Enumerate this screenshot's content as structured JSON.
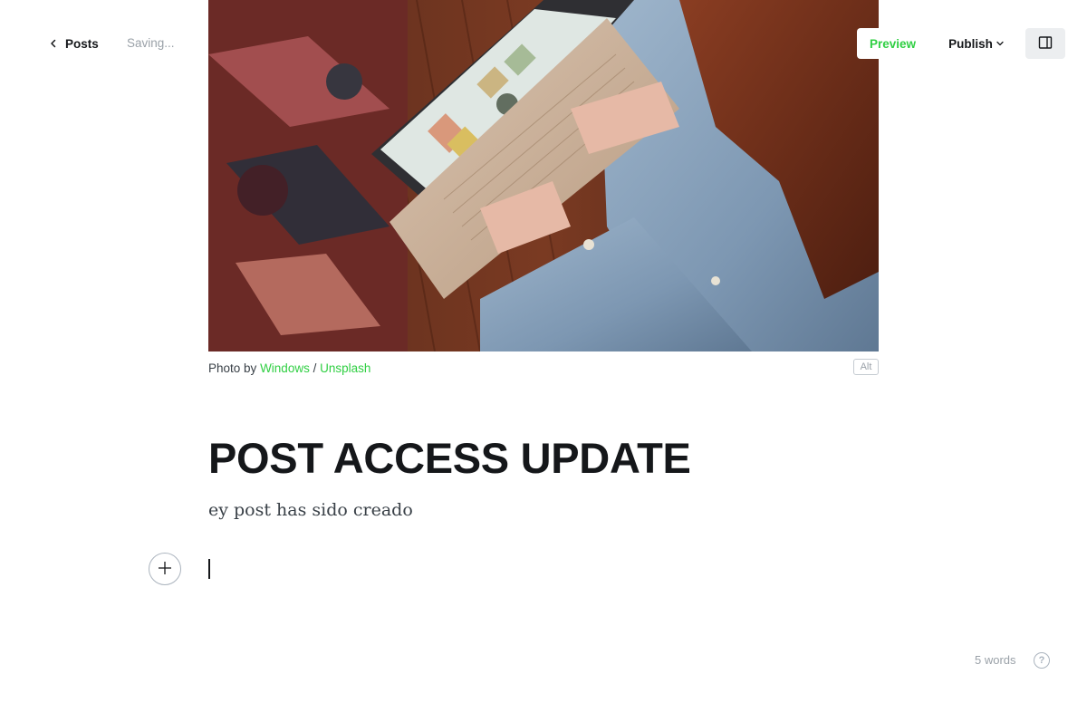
{
  "header": {
    "back_label": "Posts",
    "status_text": "Saving...",
    "preview_label": "Preview",
    "publish_label": "Publish"
  },
  "feature_image": {
    "caption_prefix": "Photo by",
    "caption_author": "Windows",
    "caption_separator": "/",
    "caption_source": "Unsplash",
    "alt_label": "Alt"
  },
  "post": {
    "title": "POST ACCESS UPDATE",
    "excerpt": "ey post has sido creado"
  },
  "footer": {
    "word_count": "5 words",
    "help_label": "?"
  },
  "colors": {
    "accent": "#30cf43",
    "text": "#15171a",
    "muted": "#9aa1a8"
  },
  "icons": {
    "back": "chevron-left-icon",
    "publish": "chevron-down-icon",
    "sidebar": "sidebar-panel-icon",
    "add": "plus-icon",
    "help": "question-icon"
  }
}
